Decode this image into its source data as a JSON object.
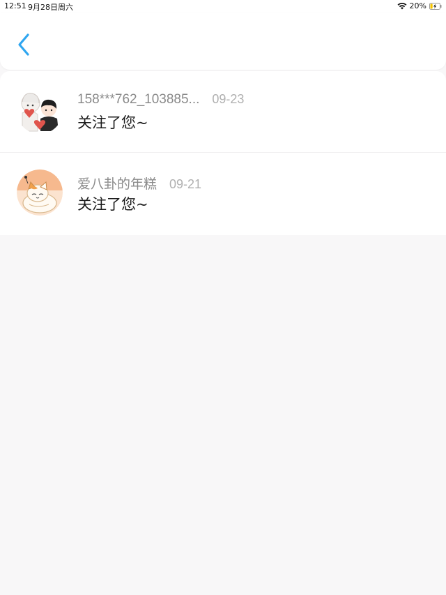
{
  "status_bar": {
    "time": "12:51",
    "date": "9月28日周六",
    "battery": "20%"
  },
  "colors": {
    "accent": "#2fa6f0",
    "background": "#f8f7f8",
    "card": "#ffffff"
  },
  "notifications": [
    {
      "username": "158***762_103885...",
      "date": "09-23",
      "message": "关注了您~",
      "avatar_icon": "couple-love-you-avatar"
    },
    {
      "username": "爱八卦的年糕",
      "date": "09-21",
      "message": "关注了您~",
      "avatar_icon": "cat-avatar"
    }
  ]
}
